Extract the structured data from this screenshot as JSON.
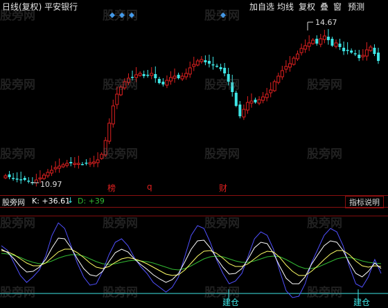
{
  "window": {
    "title": "日线(复权) 平安银行"
  },
  "toolbar": {
    "items": [
      "加自选",
      "均线",
      "复权",
      "叠",
      "窗",
      "预测"
    ]
  },
  "price_chart": {
    "high_label": "14.67",
    "low_label": "10.97",
    "event_marks": [
      "榜",
      "q",
      "财"
    ]
  },
  "indicator_panel": {
    "name": "股旁网",
    "k_label": "K: +36.61",
    "k_arrow": "↓",
    "d_label": "D: +39",
    "explain_button": "指标说明",
    "signal_labels": [
      "建仓",
      "建仓"
    ]
  },
  "watermark": {
    "text": "股旁网"
  },
  "colors": {
    "up": "#e02020",
    "down": "#3ee6e6",
    "k_line": "#ffffff",
    "d_line": "#ffff66",
    "j_line": "#5050ff",
    "g_line": "#33bb33",
    "diamond": "#3aa0ff",
    "divider": "#8a1010"
  }
}
